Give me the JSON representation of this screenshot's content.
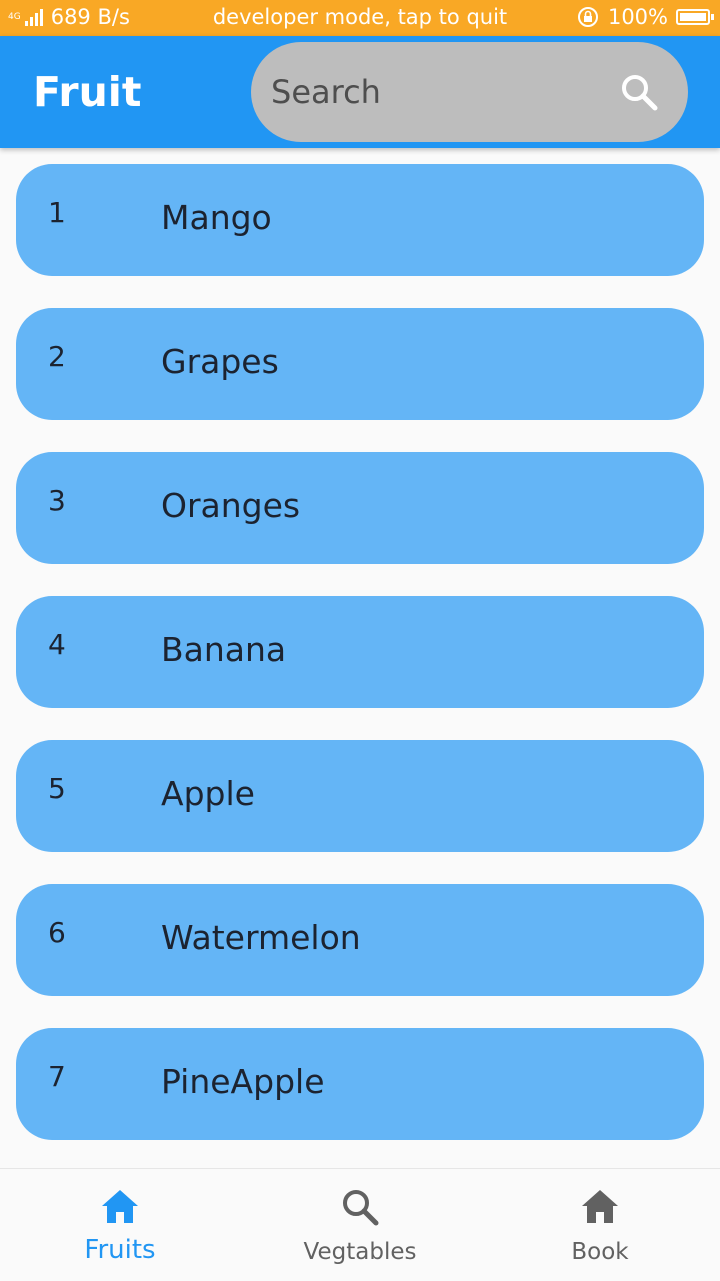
{
  "status_bar": {
    "network_type": "4G",
    "speed": "689 B/s",
    "message": "developer mode, tap to quit",
    "battery": "100%"
  },
  "app_bar": {
    "title": "Fruit",
    "search_placeholder": "Search"
  },
  "items": [
    {
      "number": "1",
      "name": "Mango"
    },
    {
      "number": "2",
      "name": "Grapes"
    },
    {
      "number": "3",
      "name": "Oranges"
    },
    {
      "number": "4",
      "name": "Banana"
    },
    {
      "number": "5",
      "name": "Apple"
    },
    {
      "number": "6",
      "name": "Watermelon"
    },
    {
      "number": "7",
      "name": "PineApple"
    }
  ],
  "bottom_nav": {
    "items": [
      {
        "label": "Fruits",
        "icon": "home-icon",
        "active": true
      },
      {
        "label": "Vegtables",
        "icon": "search-icon",
        "active": false
      },
      {
        "label": "Book",
        "icon": "home-icon",
        "active": false
      }
    ]
  },
  "colors": {
    "status_bar": "#f9a825",
    "app_bar": "#2196f3",
    "card": "#64b5f6",
    "search_field": "#bdbdbd",
    "nav_active": "#2196f3",
    "nav_inactive": "#616161"
  }
}
